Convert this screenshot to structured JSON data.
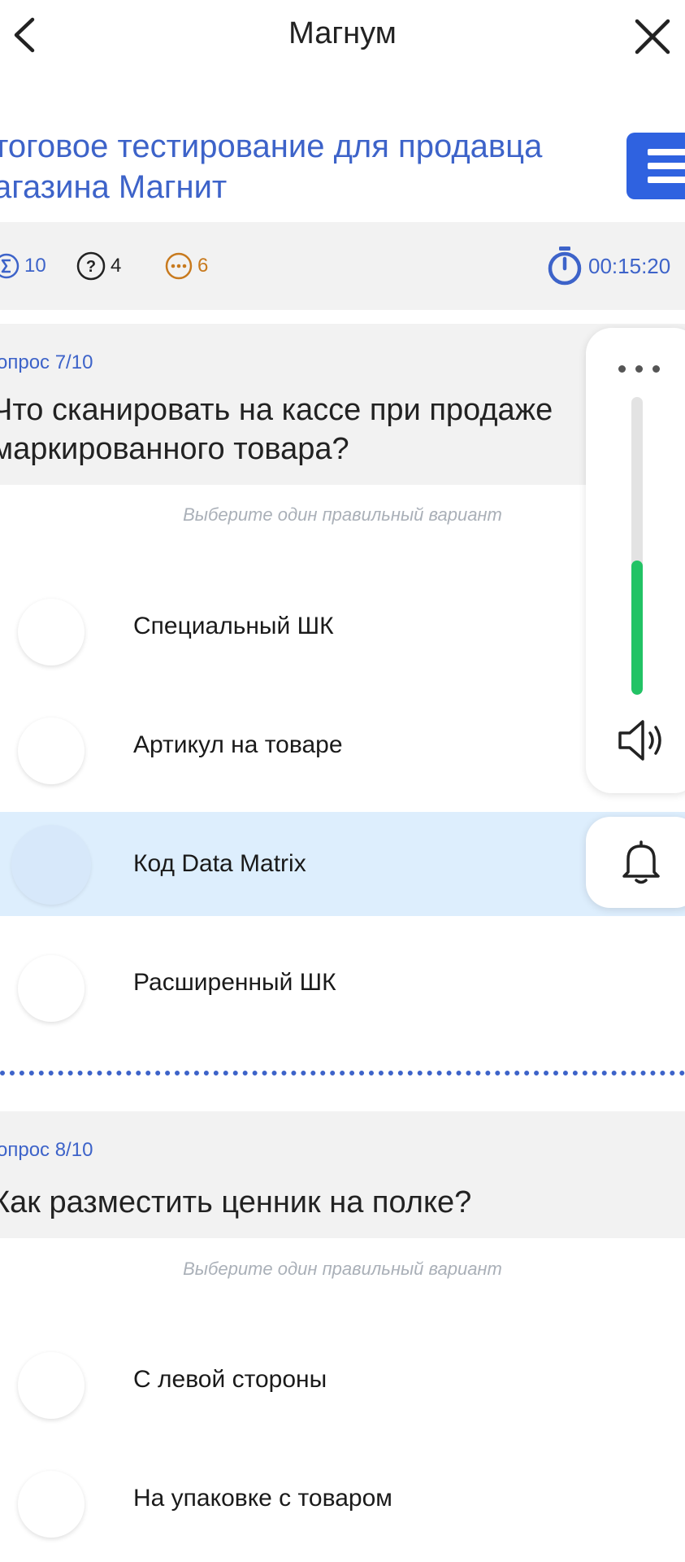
{
  "header": {
    "title": "Магнум"
  },
  "test": {
    "title_line1": "тоговое тестирование для продавца",
    "title_line2": "агазина Магнит"
  },
  "stats": {
    "total": "10",
    "questions": "4",
    "skipped": "6",
    "timer": "00:15:20"
  },
  "questions": [
    {
      "number": "опрос 7/10",
      "text_line1": "Что сканировать на кассе при продаже",
      "text_line2": "маркированного товара?",
      "hint": "Выберите один правильный вариант",
      "options": [
        {
          "label": "Специальный ШК",
          "selected": false
        },
        {
          "label": "Артикул на товаре",
          "selected": false
        },
        {
          "label": "Код Data Matrix",
          "selected": true
        },
        {
          "label": "Расширенный ШК",
          "selected": false
        }
      ]
    },
    {
      "number": "опрос 8/10",
      "text_line1": "Как разместить ценник на полке?",
      "hint": "Выберите один правильный вариант",
      "options": [
        {
          "label": "С левой стороны",
          "selected": false
        },
        {
          "label": "На упаковке с товаром",
          "selected": false
        }
      ]
    }
  ],
  "side_panel": {
    "volume_level": 0.45
  },
  "colors": {
    "accent": "#3d63c9",
    "menu_button": "#2f62e0",
    "volume": "#22c365",
    "selected_bg": "#ddeefd",
    "skip": "#c87a1e"
  },
  "icons": [
    "back-icon",
    "close-icon",
    "menu-icon",
    "sum-icon",
    "question-icon",
    "skip-icon",
    "stopwatch-icon",
    "more-icon",
    "speaker-icon",
    "bell-icon"
  ]
}
